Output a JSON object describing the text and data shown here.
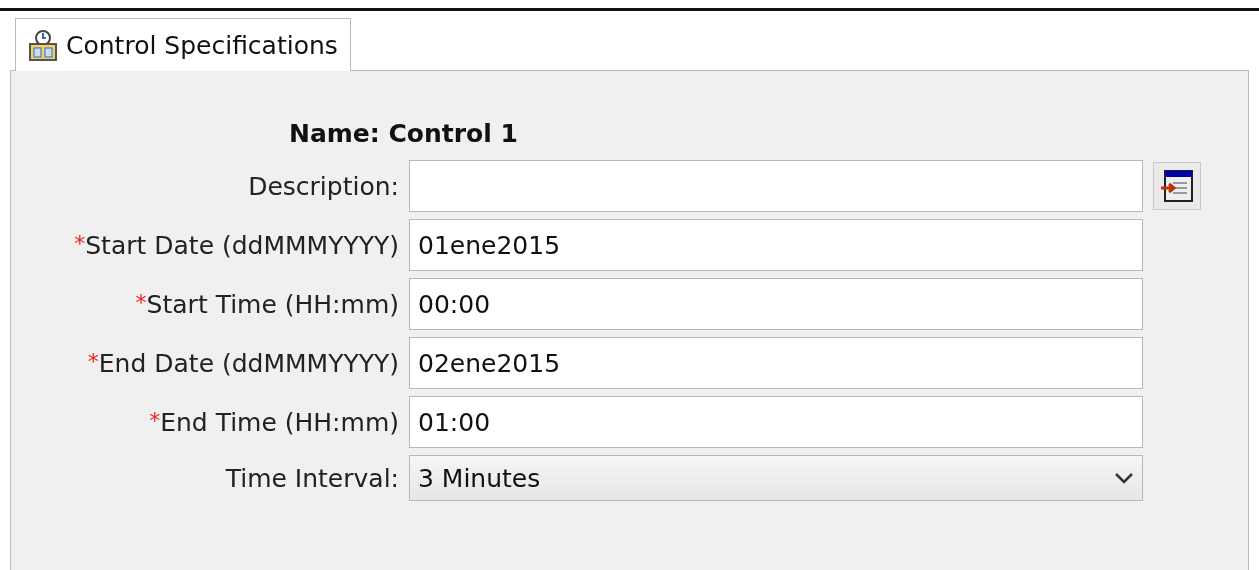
{
  "tabs": [
    {
      "label": "Control Specifications",
      "selected": true
    }
  ],
  "name": {
    "label": "Name:",
    "value": "Control 1"
  },
  "description": {
    "label": "Description:"
  },
  "fields": [
    {
      "kind": "text",
      "marker": "*",
      "label": "Start Date (ddMMMYYYY)",
      "value": "01ene2015"
    },
    {
      "kind": "text",
      "marker": "*",
      "label": "Start Time (HH:mm)",
      "value": "00:00"
    },
    {
      "kind": "text",
      "marker": "*",
      "label": "End Date (ddMMMYYYY)",
      "value": "02ene2015"
    },
    {
      "kind": "text",
      "marker": "*",
      "label": "End Time (HH:mm)",
      "value": "01:00"
    },
    {
      "kind": "select",
      "label": "Time Interval:",
      "value": "3 Minutes"
    }
  ]
}
